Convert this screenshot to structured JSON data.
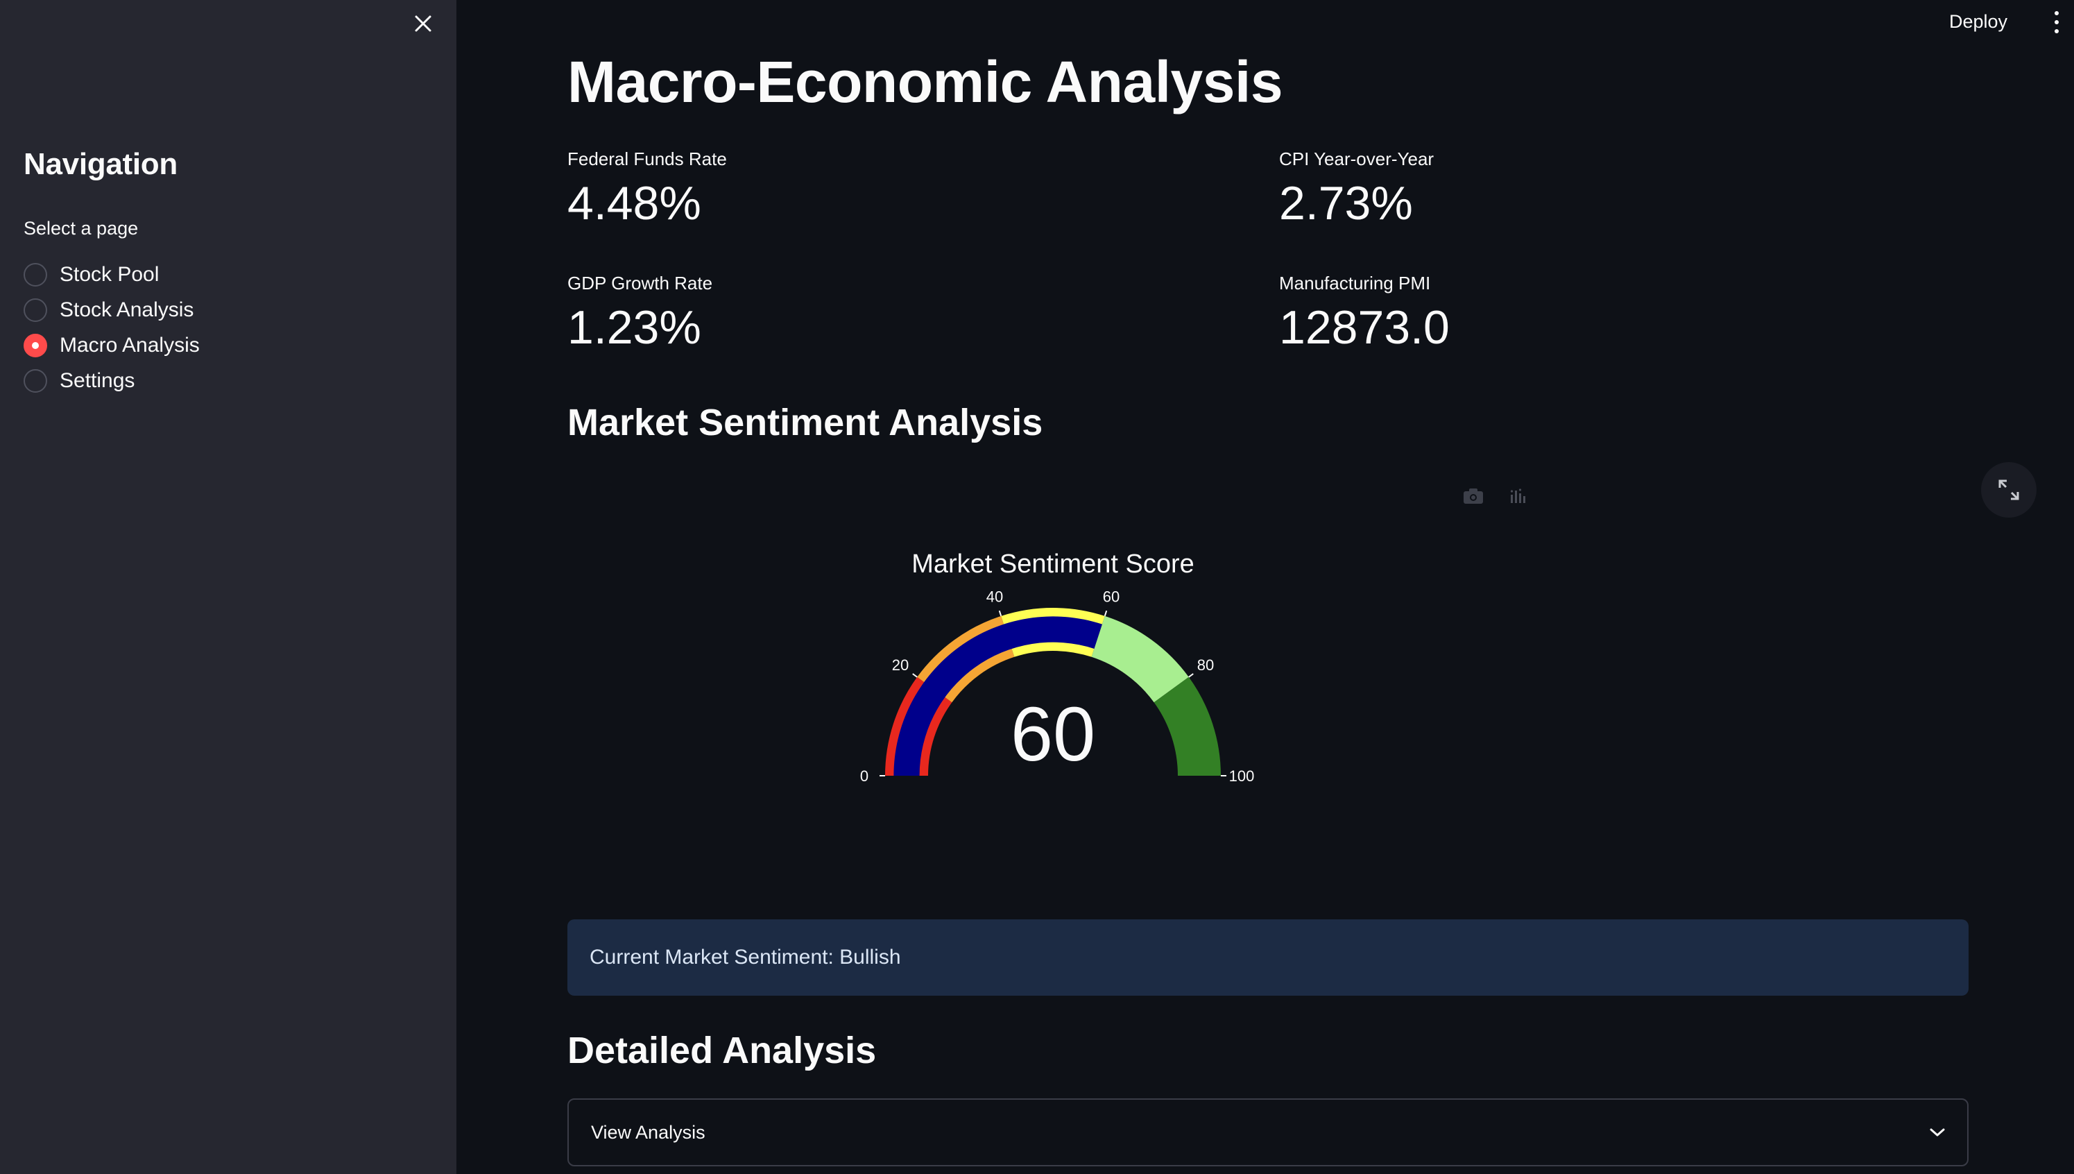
{
  "header": {
    "deploy_label": "Deploy",
    "menu_icon": "kebab-menu-icon"
  },
  "sidebar": {
    "close_icon": "close-icon",
    "title": "Navigation",
    "select_label": "Select a page",
    "items": [
      {
        "label": "Stock Pool",
        "checked": false
      },
      {
        "label": "Stock Analysis",
        "checked": false
      },
      {
        "label": "Macro Analysis",
        "checked": true
      },
      {
        "label": "Settings",
        "checked": false
      }
    ]
  },
  "main": {
    "title": "Macro-Economic Analysis",
    "metrics": [
      {
        "label": "Federal Funds Rate",
        "value": "4.48%"
      },
      {
        "label": "CPI Year-over-Year",
        "value": "2.73%"
      },
      {
        "label": "GDP Growth Rate",
        "value": "1.23%"
      },
      {
        "label": "Manufacturing PMI",
        "value": "12873.0"
      }
    ],
    "sentiment_section_title": "Market Sentiment Analysis",
    "info_text": "Current Market Sentiment: Bullish",
    "detail_section_title": "Detailed Analysis",
    "expander_label": "View Analysis"
  },
  "chart_data": {
    "type": "gauge",
    "title": "Market Sentiment Score",
    "value": 60,
    "range": [
      0,
      100
    ],
    "ticks": [
      "0",
      "20",
      "40",
      "60",
      "80",
      "100"
    ],
    "tick_values": [
      0,
      20,
      40,
      60,
      80,
      100
    ],
    "bar_color": "#00008b",
    "steps": [
      {
        "range": [
          0,
          20
        ],
        "color": "#e8281e"
      },
      {
        "range": [
          20,
          40
        ],
        "color": "#f5a534"
      },
      {
        "range": [
          40,
          60
        ],
        "color": "#ffff54"
      },
      {
        "range": [
          60,
          80
        ],
        "color": "#a8ee90"
      },
      {
        "range": [
          80,
          100
        ],
        "color": "#338025"
      }
    ]
  },
  "colors": {
    "accent": "#ff4b4b",
    "background": "#0e1117",
    "sidebar": "#262730",
    "info_background": "#1c2b44"
  }
}
